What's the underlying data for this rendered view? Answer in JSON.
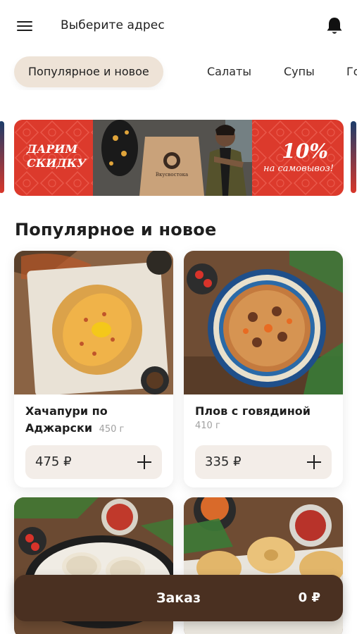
{
  "header": {
    "address_label": "Выберите адрес",
    "menu_icon": "hamburger-menu-icon",
    "bell_icon": "bell-icon"
  },
  "categories": [
    {
      "label": "Популярное и новое",
      "active": true
    },
    {
      "label": "Салаты",
      "active": false
    },
    {
      "label": "Супы",
      "active": false
    },
    {
      "label": "Го",
      "active": false
    }
  ],
  "promo_banner": {
    "headline_line1": "Дарим",
    "headline_line2": "скидку",
    "discount": "10%",
    "subtitle": "на самовывоз!",
    "bag_logo": "Вкусвостока",
    "background_color": "#dc3a2c"
  },
  "section": {
    "title": "Популярное и новое"
  },
  "products": [
    {
      "name": "Хачапури по Аджарски",
      "weight": "450 г",
      "price": "475 ₽"
    },
    {
      "name": "Плов с говядиной",
      "weight": "410 г",
      "price": "335 ₽"
    },
    {
      "name": "",
      "weight": "",
      "price": ""
    },
    {
      "name": "",
      "weight": "",
      "price": ""
    }
  ],
  "order_bar": {
    "label": "Заказ",
    "total": "0 ₽",
    "color": "#4a3021"
  }
}
